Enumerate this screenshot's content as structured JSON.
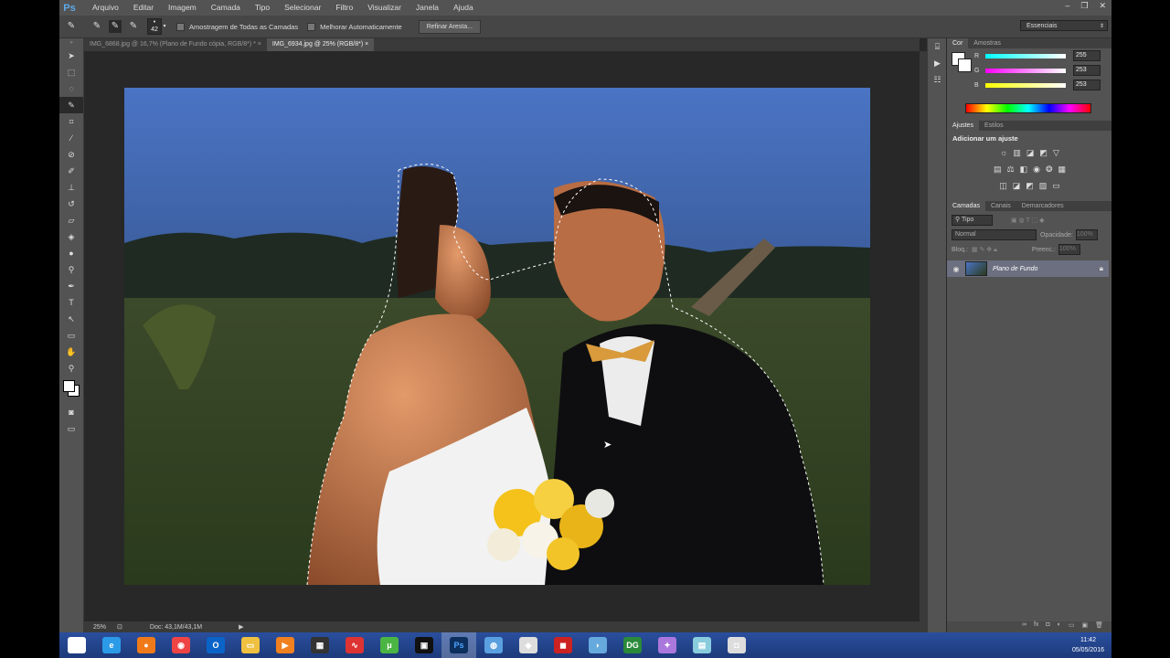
{
  "menu": {
    "logo": "Ps",
    "items": [
      "Arquivo",
      "Editar",
      "Imagem",
      "Camada",
      "Tipo",
      "Selecionar",
      "Filtro",
      "Visualizar",
      "Janela",
      "Ajuda"
    ]
  },
  "window_controls": {
    "minimize": "–",
    "restore": "❐",
    "close": "✕"
  },
  "options": {
    "brush_size": "42",
    "sample_all_layers": "Amostragem de Todas as Camadas",
    "auto_enhance": "Melhorar Automaticamente",
    "refine_edge": "Refinar Aresta...",
    "workspace": "Essenciais"
  },
  "doc_tabs": [
    {
      "label": "IMG_6868.jpg @ 16,7% (Plano de Fundo cópia, RGB/8*) *",
      "close": "×"
    },
    {
      "label": "IMG_6934.jpg @ 25% (RGB/8*)",
      "close": "×"
    }
  ],
  "status": {
    "zoom": "25%",
    "doc_size": "Doc: 43,1M/43,1M"
  },
  "color_panel": {
    "tabs": [
      "Cor",
      "Amostras"
    ],
    "channels": [
      {
        "label": "R",
        "value": "255",
        "gradient": "#00ffff"
      },
      {
        "label": "G",
        "value": "253",
        "gradient": "#ff00ff"
      },
      {
        "label": "B",
        "value": "253",
        "gradient": "#ffff00"
      }
    ]
  },
  "adjustments_panel": {
    "tabs": [
      "Ajustes",
      "Estilos"
    ],
    "title": "Adicionar um ajuste"
  },
  "layers_panel": {
    "tabs": [
      "Camadas",
      "Canais",
      "Demarcadores"
    ],
    "kind_filter": "Tipo",
    "blend_mode": "Normal",
    "opacity_label": "Opacidade:",
    "opacity_value": "100%",
    "lock_label": "Bloq.:",
    "fill_label": "Preenc.:",
    "fill_value": "100%",
    "layer_name": "Plano de Fundo"
  },
  "taskbar": {
    "apps": [
      {
        "name": "start",
        "glyph": "⊞",
        "color": "#ffffff"
      },
      {
        "name": "internet-explorer",
        "glyph": "e",
        "color": "#2b9be8"
      },
      {
        "name": "firefox",
        "glyph": "●",
        "color": "#f07a1a"
      },
      {
        "name": "chrome",
        "glyph": "◉",
        "color": "#e44"
      },
      {
        "name": "outlook",
        "glyph": "O",
        "color": "#0a64c8"
      },
      {
        "name": "file-explorer",
        "glyph": "▭",
        "color": "#f0c040"
      },
      {
        "name": "media-player",
        "glyph": "▶",
        "color": "#f08020"
      },
      {
        "name": "movie-maker",
        "glyph": "▦",
        "color": "#333"
      },
      {
        "name": "acrobat",
        "glyph": "∿",
        "color": "#d33"
      },
      {
        "name": "utorrent",
        "glyph": "μ",
        "color": "#4bb543"
      },
      {
        "name": "film-editor",
        "glyph": "▣",
        "color": "#111"
      },
      {
        "name": "photoshop",
        "glyph": "Ps",
        "color": "#0c2f5e"
      },
      {
        "name": "network",
        "glyph": "◍",
        "color": "#5aa0e0"
      },
      {
        "name": "gem-app",
        "glyph": "◆",
        "color": "#ddd"
      },
      {
        "name": "red-app",
        "glyph": "◼",
        "color": "#c22"
      },
      {
        "name": "blue-app",
        "glyph": "◗",
        "color": "#6ad"
      },
      {
        "name": "dg-app",
        "glyph": "DG",
        "color": "#2a8a3a"
      },
      {
        "name": "purple-app",
        "glyph": "✦",
        "color": "#a7d"
      },
      {
        "name": "notes-app",
        "glyph": "▤",
        "color": "#8cd"
      },
      {
        "name": "camera-app",
        "glyph": "◘",
        "color": "#ddd"
      }
    ],
    "time": "11:42",
    "date": "05/05/2016"
  },
  "colors": {
    "accent": "#6b6f7f",
    "ui_bg": "#535353",
    "canvas_bg": "#282828"
  }
}
